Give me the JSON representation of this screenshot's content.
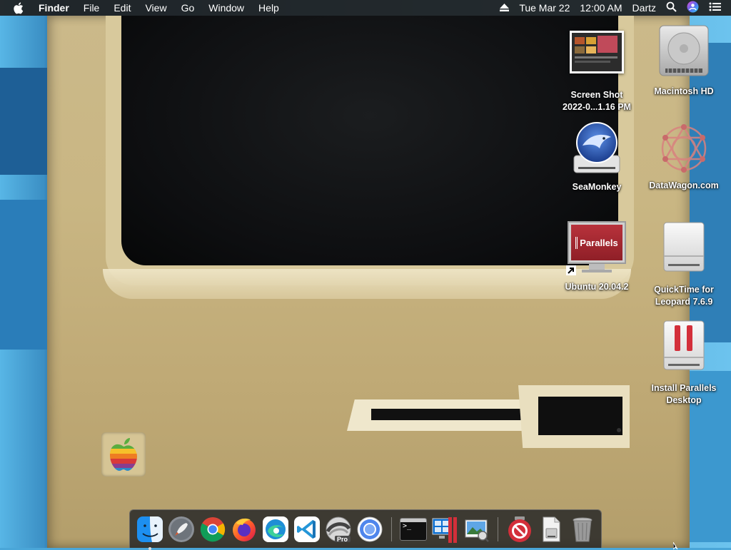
{
  "menubar": {
    "items": [
      "Finder",
      "File",
      "Edit",
      "View",
      "Go",
      "Window",
      "Help"
    ],
    "date": "Tue Mar 22",
    "time": "12:00 AM",
    "user": "Dartz",
    "icons": [
      "apple-icon",
      "eject-icon",
      "spotlight-search-icon",
      "siri-icon",
      "control-center-icon"
    ]
  },
  "desktop": {
    "icons": [
      {
        "label_line1": "Screen Shot",
        "label_line2": "2022-0...1.16 PM",
        "icon": "screenshot-thumbnail"
      },
      {
        "label_line1": "Macintosh HD",
        "label_line2": "",
        "icon": "hard-drive-icon"
      },
      {
        "label_line1": "SeaMonkey",
        "label_line2": "",
        "icon": "seamonkey-disk-icon"
      },
      {
        "label_line1": "DataWagon.com",
        "label_line2": "",
        "icon": "datawagon-icon"
      },
      {
        "label_line1": "Ubuntu 20.04.2",
        "label_line2": "",
        "icon": "parallels-alias-icon",
        "badge": "Parallels"
      },
      {
        "label_line1": "QuickTime for",
        "label_line2": "Leopard 7.6.9",
        "icon": "removable-disk-icon"
      },
      {
        "label_line1": "Install Parallels",
        "label_line2": "Desktop",
        "icon": "parallels-installer-icon"
      }
    ]
  },
  "dock": {
    "apps": [
      "Finder",
      "Launchpad",
      "Google Chrome",
      "Firefox",
      "Microsoft Edge",
      "Visual Studio Code",
      "Final Cut Pro",
      "Chromium",
      "Terminal",
      "Parallels Desktop",
      "Preview",
      "Parallels Installer",
      "Disk Image",
      "Trash"
    ],
    "pro_badge": "Pro",
    "terminal_prompt": ">_"
  },
  "colors": {
    "menubar_bg": "#1e1e1e",
    "wallpaper_blue": "#3b8fc4",
    "mac_beige": "#c9b683",
    "parallels_red": "#d32f3a"
  }
}
